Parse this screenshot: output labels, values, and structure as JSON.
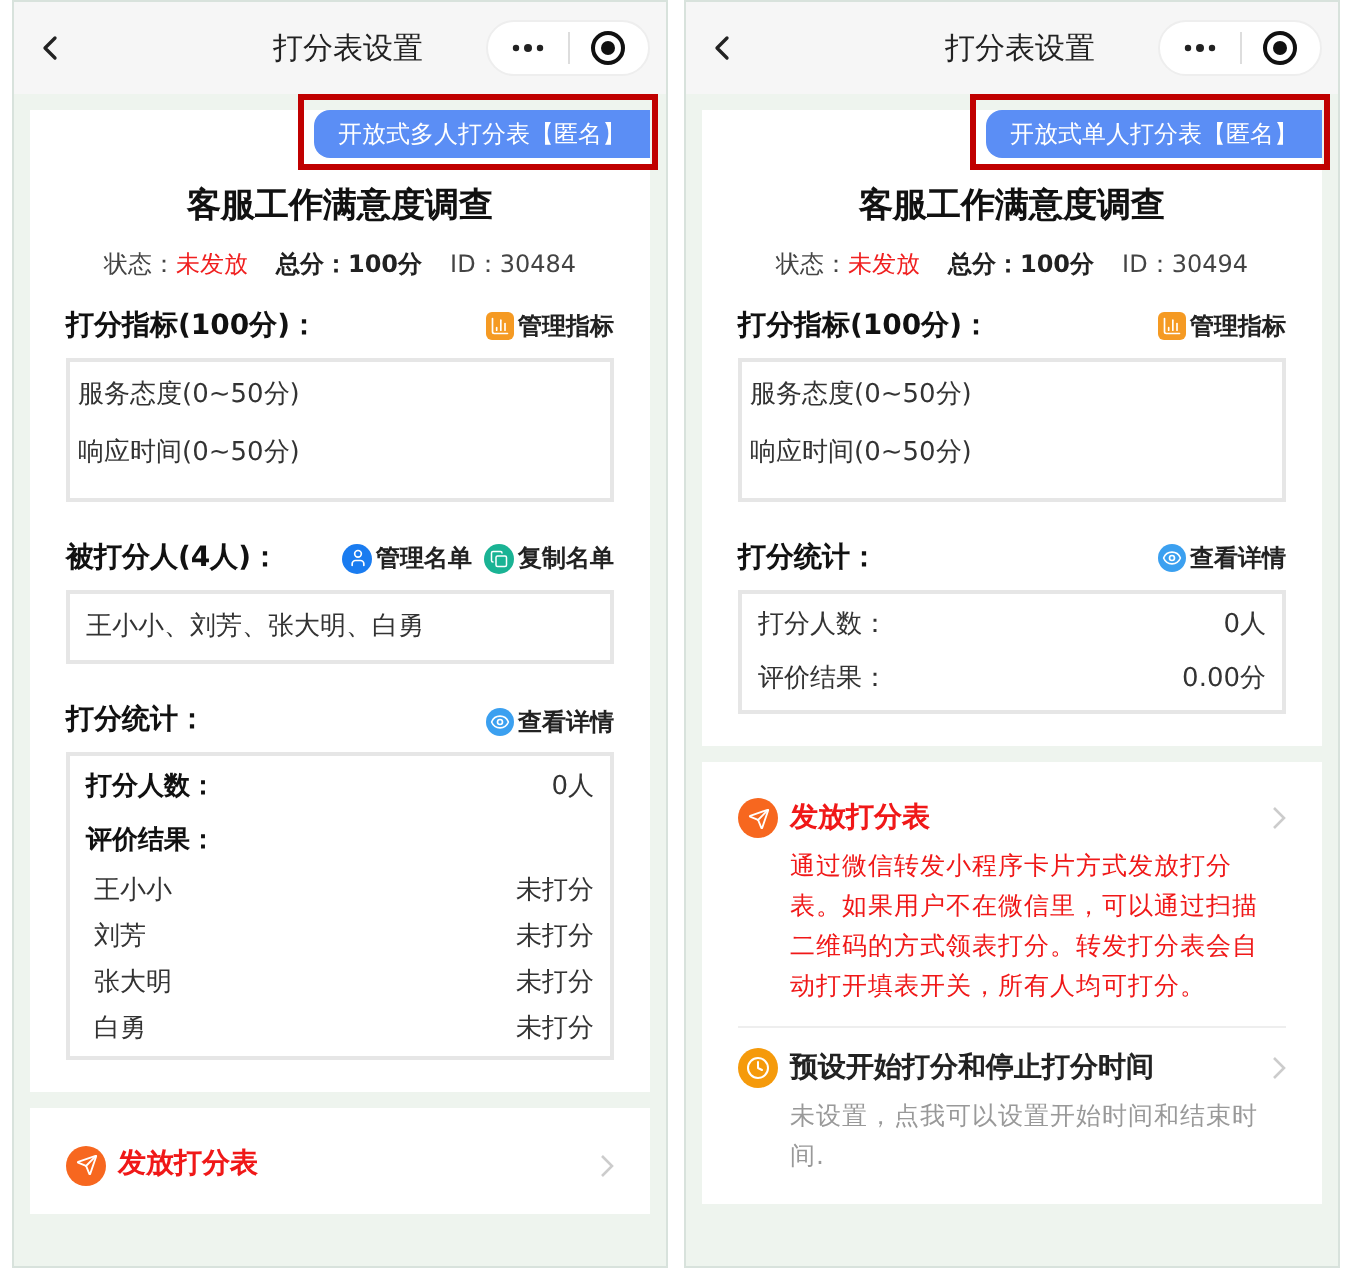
{
  "screens": [
    {
      "nav": {
        "title": "打分表设置"
      },
      "badge": "开放式多人打分表【匿名】",
      "title": "客服工作满意度调查",
      "meta": {
        "status_label": "状态：",
        "status": "未发放",
        "total": "总分：100分",
        "id": "ID：30484"
      },
      "sections": [
        {
          "kind": "list",
          "heading": "打分指标(100分)：",
          "actions": [
            {
              "kind": "chart",
              "label": "管理指标"
            }
          ],
          "lines": [
            "服务态度(0~50分)",
            "响应时间(0~50分)"
          ]
        },
        {
          "kind": "text",
          "heading": "被打分人(4人)：",
          "actions": [
            {
              "kind": "user",
              "label": "管理名单"
            },
            {
              "kind": "copy",
              "label": "复制名单"
            }
          ],
          "text": "王小小、刘芳、张大明、白勇"
        },
        {
          "kind": "stats",
          "heading": "打分统计：",
          "actions": [
            {
              "kind": "eye",
              "label": "查看详情"
            }
          ],
          "rows": [
            {
              "label": "打分人数：",
              "value": "0人",
              "bold": true
            },
            {
              "label": "评价结果：",
              "bold": true
            }
          ],
          "results": [
            {
              "name": "王小小",
              "value": "未打分"
            },
            {
              "name": "刘芳",
              "value": "未打分"
            },
            {
              "name": "张大明",
              "value": "未打分"
            },
            {
              "name": "白勇",
              "value": "未打分"
            }
          ]
        }
      ],
      "steps": [
        {
          "kind": "publish",
          "title": "发放打分表"
        }
      ]
    },
    {
      "nav": {
        "title": "打分表设置"
      },
      "badge": "开放式单人打分表【匿名】",
      "title": "客服工作满意度调查",
      "meta": {
        "status_label": "状态：",
        "status": "未发放",
        "total": "总分：100分",
        "id": "ID：30494"
      },
      "sections": [
        {
          "kind": "list",
          "heading": "打分指标(100分)：",
          "actions": [
            {
              "kind": "chart",
              "label": "管理指标"
            }
          ],
          "lines": [
            "服务态度(0~50分)",
            "响应时间(0~50分)"
          ]
        },
        {
          "kind": "stats",
          "heading": "打分统计：",
          "actions": [
            {
              "kind": "eye",
              "label": "查看详情"
            }
          ],
          "rows": [
            {
              "label": "打分人数：",
              "value": "0人",
              "bold": false
            },
            {
              "label": "评价结果：",
              "value": "0.00分",
              "bold": false
            }
          ]
        }
      ],
      "steps": [
        {
          "kind": "publish",
          "title": "发放打分表",
          "description": "通过微信转发小程序卡片方式发放打分表。如果用户不在微信里，可以通过扫描二维码的方式领表打分。转发打分表会自动打开填表开关，所有人均可打分。"
        },
        {
          "kind": "schedule",
          "title": "预设开始打分和停止打分时间",
          "description": "未设置，点我可以设置开始时间和结束时间."
        }
      ]
    }
  ]
}
